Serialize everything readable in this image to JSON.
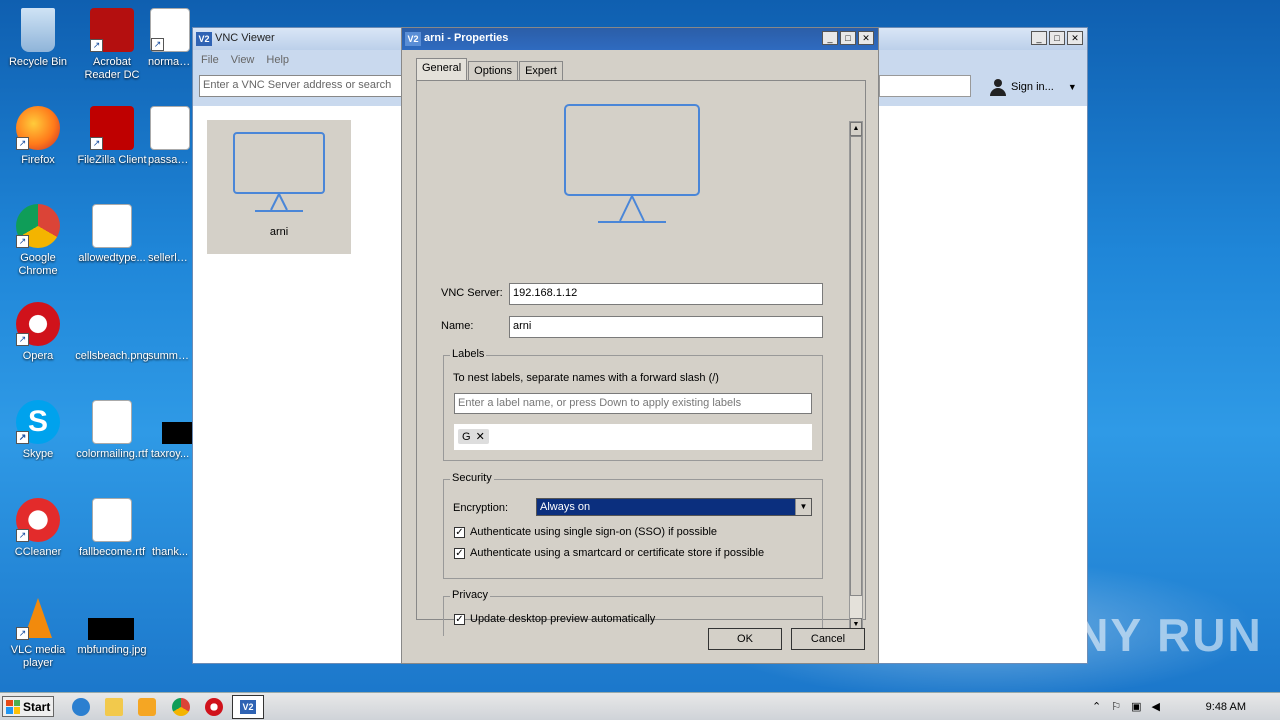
{
  "desktop": {
    "icons": [
      {
        "label": "Recycle Bin"
      },
      {
        "label": "Acrobat Reader DC"
      },
      {
        "label": "normalr..."
      },
      {
        "label": "Firefox"
      },
      {
        "label": "FileZilla Client"
      },
      {
        "label": "passag..."
      },
      {
        "label": "Google Chrome"
      },
      {
        "label": "allowedtype..."
      },
      {
        "label": "sellerlo..."
      },
      {
        "label": "Opera"
      },
      {
        "label": "cellsbeach.png"
      },
      {
        "label": "summer..."
      },
      {
        "label": "Skype"
      },
      {
        "label": "colormailing.rtf"
      },
      {
        "label": "taxroy..."
      },
      {
        "label": "CCleaner"
      },
      {
        "label": "fallbecome.rtf"
      },
      {
        "label": "thank..."
      },
      {
        "label": "VLC media player"
      },
      {
        "label": "mbfunding.jpg"
      }
    ]
  },
  "viewer": {
    "title": "VNC Viewer",
    "menu": [
      "File",
      "View",
      "Help"
    ],
    "search_placeholder": "Enter a VNC Server address or search",
    "signin": "Sign in...",
    "tile_label": "arni"
  },
  "dialog": {
    "title": "arni - Properties",
    "tabs": [
      "General",
      "Options",
      "Expert"
    ],
    "server_label": "VNC Server:",
    "server_value": "192.168.1.12",
    "name_label": "Name:",
    "name_value": "arni",
    "labels": {
      "title": "Labels",
      "hint": "To nest labels, separate names with a forward slash (/)",
      "placeholder": "Enter a label name, or press Down to apply existing labels",
      "tag": "G"
    },
    "security": {
      "title": "Security",
      "encryption_label": "Encryption:",
      "encryption_value": "Always on",
      "sso": "Authenticate using single sign-on (SSO) if possible",
      "smartcard": "Authenticate using a smartcard or certificate store if possible"
    },
    "privacy": {
      "title": "Privacy",
      "preview": "Update desktop preview automatically"
    },
    "ok": "OK",
    "cancel": "Cancel"
  },
  "taskbar": {
    "start": "Start",
    "time": "9:48 AM"
  },
  "watermark": "ANY RUN"
}
